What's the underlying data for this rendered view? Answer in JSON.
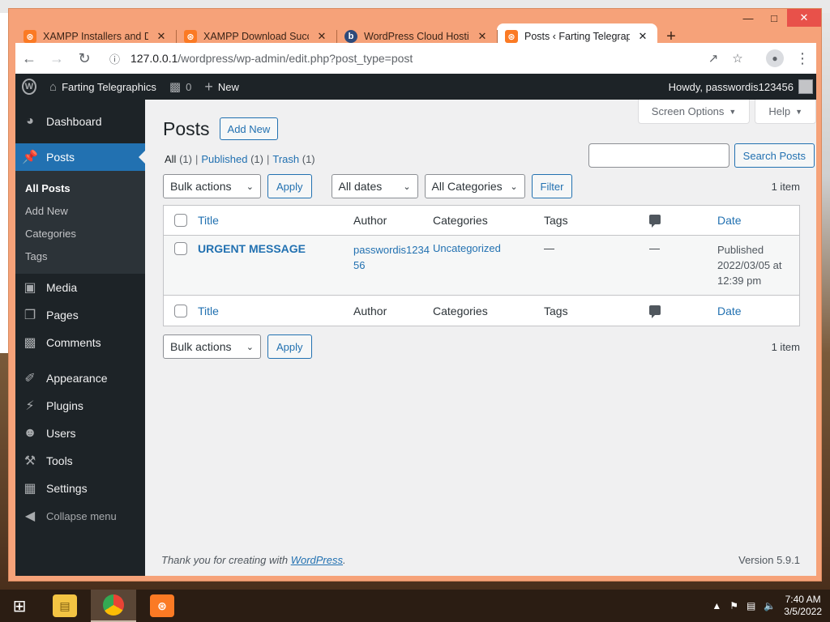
{
  "browser": {
    "tabs": [
      {
        "title": "XAMPP Installers and Do",
        "icon": "xampp-icon",
        "active": false
      },
      {
        "title": "XAMPP Download Succe",
        "icon": "xampp-icon",
        "active": false
      },
      {
        "title": "WordPress Cloud Hostin",
        "icon": "wordpress-icon",
        "active": false
      },
      {
        "title": "Posts ‹ Farting Telegraphi",
        "icon": "xampp-icon",
        "active": true
      }
    ],
    "url_host": "127.0.0.1",
    "url_path": "/wordpress/wp-admin/edit.php?post_type=post"
  },
  "adminbar": {
    "site_name": "Farting Telegraphics",
    "comments_count": "0",
    "new_label": "New",
    "howdy": "Howdy, passwordis123456"
  },
  "sidebar": {
    "dashboard": "Dashboard",
    "posts": "Posts",
    "sub": [
      "All Posts",
      "Add New",
      "Categories",
      "Tags"
    ],
    "media": "Media",
    "pages": "Pages",
    "comments": "Comments",
    "appearance": "Appearance",
    "plugins": "Plugins",
    "users": "Users",
    "tools": "Tools",
    "settings": "Settings",
    "collapse": "Collapse menu"
  },
  "content": {
    "screen_options": "Screen Options",
    "help": "Help",
    "title": "Posts",
    "add_new": "Add New",
    "views": {
      "all": "All",
      "all_count": "(1)",
      "published": "Published",
      "published_count": "(1)",
      "trash": "Trash",
      "trash_count": "(1)",
      "sep": "|"
    },
    "search_button": "Search Posts",
    "bulk_actions": "Bulk actions",
    "apply": "Apply",
    "all_dates": "All dates",
    "all_categories": "All Categories",
    "filter": "Filter",
    "items_count": "1 item",
    "columns": {
      "title": "Title",
      "author": "Author",
      "categories": "Categories",
      "tags": "Tags",
      "date": "Date"
    },
    "row": {
      "title": "URGENT MESSAGE",
      "author": "passwordis123456",
      "category": "Uncategorized",
      "tags": "—",
      "comments": "—",
      "date_status": "Published",
      "date_line1": "2022/03/05 at",
      "date_line2": "12:39 pm"
    }
  },
  "footer": {
    "thanks_pre": "Thank you for creating with",
    "wordpress": "WordPress",
    "thanks_post": ".",
    "version": "Version 5.9.1"
  },
  "taskbar": {
    "time": "7:40 AM",
    "date": "3/5/2022"
  }
}
